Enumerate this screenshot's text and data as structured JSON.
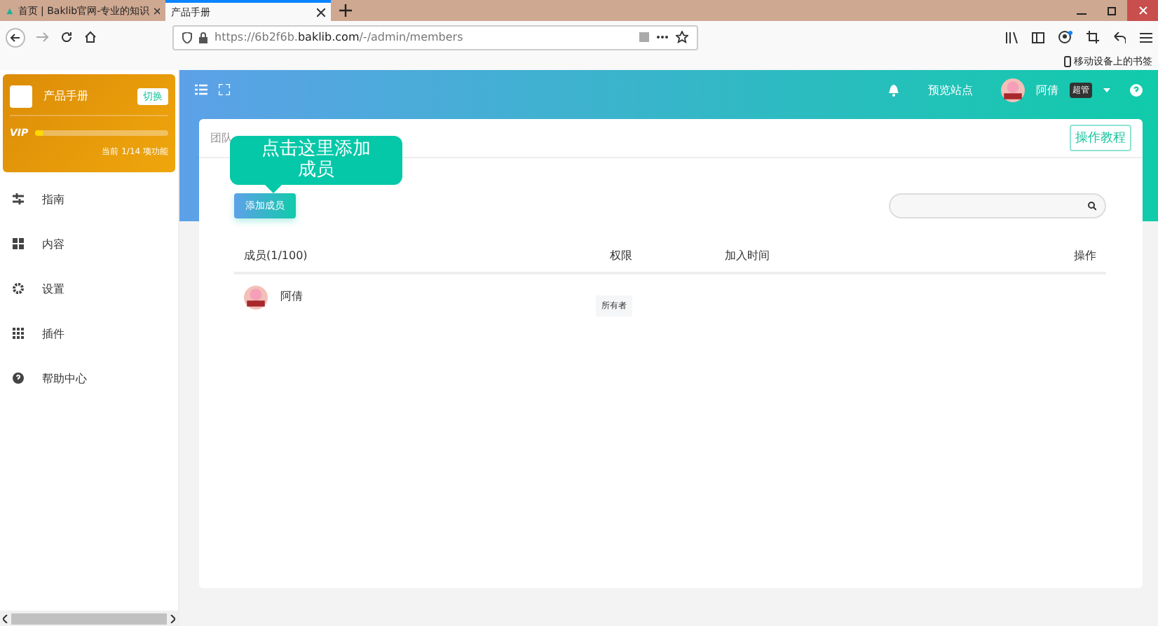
{
  "browser": {
    "tabs": [
      {
        "label": "首页 | Baklib官网-专业的知识",
        "selected": false
      },
      {
        "label": "产品手册",
        "selected": true
      }
    ],
    "url": "https://6b2f6b.**baklib.com**/-/admin/members",
    "bookmarks": "移动设备上的书签"
  },
  "sidebar": {
    "site_name": "产品手册",
    "switch_button": "切换",
    "vip": "VIP",
    "level": 0.06,
    "usage": "当前 1/14 项功能",
    "items": [
      {
        "label": "指南"
      },
      {
        "label": "内容"
      },
      {
        "label": "设置"
      },
      {
        "label": "插件"
      },
      {
        "label": "帮助中心"
      }
    ]
  },
  "header": {
    "preview": "预览站点",
    "user": "阿倩",
    "role_badge": "超管"
  },
  "card": {
    "title": "团队",
    "tutorial_button": "操作教程",
    "add_button": "添加成员",
    "tooltip": "点击这里添加成员",
    "columns": [
      "成员(1/100)",
      "权限",
      "加入时间",
      "操作"
    ],
    "rows": [
      {
        "name": "阿倩",
        "role": "所有者"
      }
    ]
  }
}
